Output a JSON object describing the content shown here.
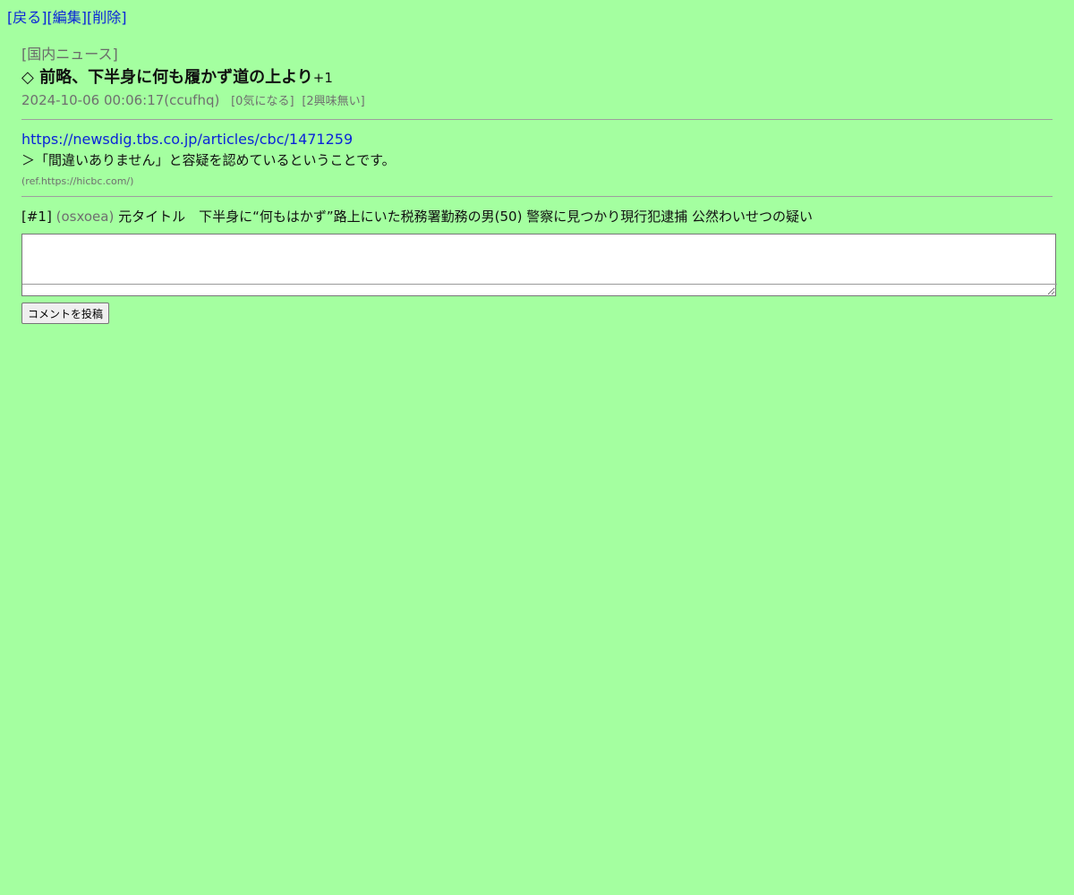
{
  "nav": {
    "back": "[戻る]",
    "edit": "[編集]",
    "delete": "[削除]"
  },
  "post": {
    "category": "[国内ニュース]",
    "title": "◇ 前略、下半身に何も履かず道の上より",
    "score": "+1",
    "datetime_user": "2024-10-06 00:06:17(ccufhq)",
    "interested": "[0気になる]",
    "not_interested": "[2興味無い]",
    "link": "https://newsdig.tbs.co.jp/articles/cbc/1471259",
    "quote": "＞「間違いありません」と容疑を認めているということです。",
    "ref": "(ref.https://hicbc.com/)"
  },
  "comments": [
    {
      "num": "[#1]",
      "user": "(osxoea)",
      "text": "元タイトル　下半身に“何もはかず”路上にいた税務署勤務の男(50) 警察に見つかり現行犯逮捕 公然わいせつの疑い"
    }
  ],
  "form": {
    "textarea_value": "",
    "submit_label": "コメントを投稿"
  },
  "colors": {
    "background": "#a4ffa0",
    "link": "#0a24d8",
    "muted": "#6f6f6f"
  }
}
